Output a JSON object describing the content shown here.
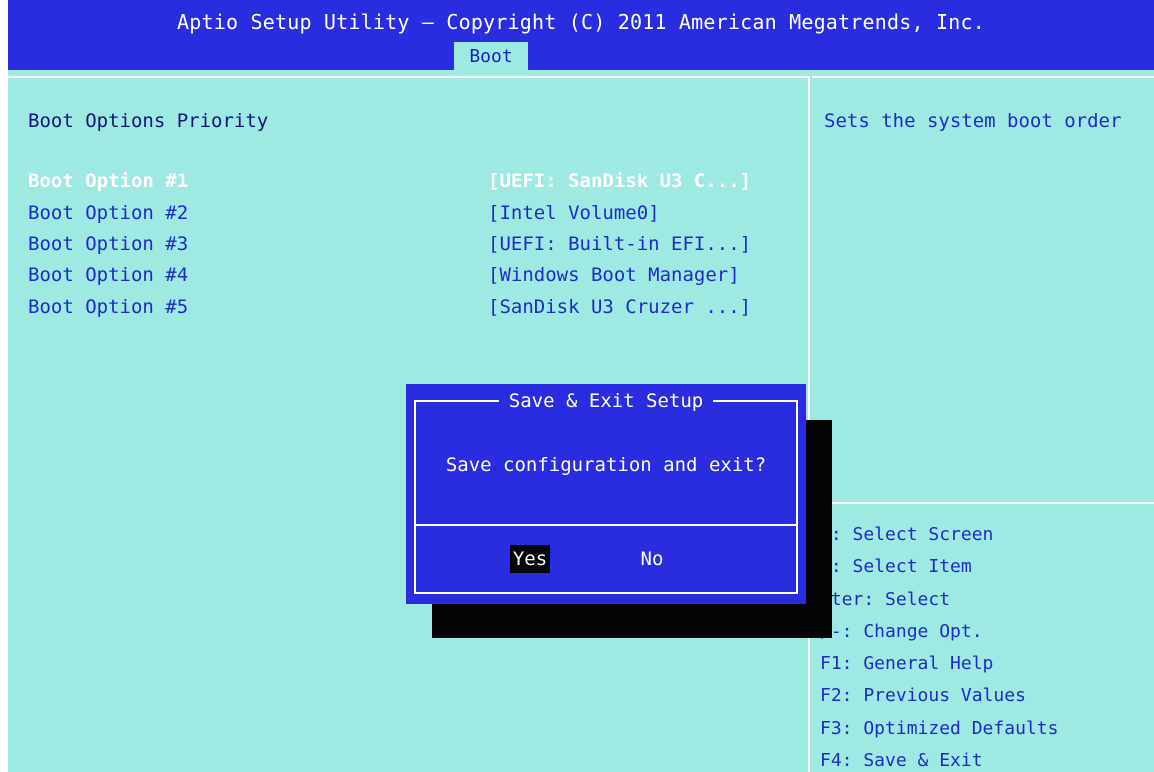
{
  "header": {
    "title": "Aptio Setup Utility – Copyright (C) 2011 American Megatrends, Inc.",
    "active_tab": "Boot"
  },
  "main": {
    "section_title": "Boot Options Priority",
    "options": [
      {
        "label": "Boot Option #1",
        "value": "[UEFI: SanDisk U3 C...]",
        "selected": true
      },
      {
        "label": "Boot Option #2",
        "value": "[Intel Volume0]",
        "selected": false
      },
      {
        "label": "Boot Option #3",
        "value": "[UEFI: Built-in EFI...]",
        "selected": false
      },
      {
        "label": "Boot Option #4",
        "value": "[Windows Boot Manager]",
        "selected": false
      },
      {
        "label": "Boot Option #5",
        "value": "[SanDisk U3 Cruzer ...]",
        "selected": false
      }
    ]
  },
  "help": {
    "text": "Sets the system boot order",
    "keys": [
      "←: Select Screen",
      "↓: Select Item",
      "nter: Select",
      "/-: Change Opt.",
      "F1: General Help",
      "F2: Previous Values",
      "F3: Optimized Defaults",
      "F4: Save & Exit"
    ]
  },
  "dialog": {
    "title": "Save & Exit Setup",
    "message": "Save configuration and exit?",
    "yes_label": "Yes",
    "no_label": "No",
    "focused_button": "Yes"
  },
  "colors": {
    "header_bg": "#2a2ce0",
    "screen_bg": "#9ee9e2",
    "text_blue": "#1e2ac8",
    "dialog_bg": "#2a2ce0",
    "selected_text": "#ffffff"
  }
}
